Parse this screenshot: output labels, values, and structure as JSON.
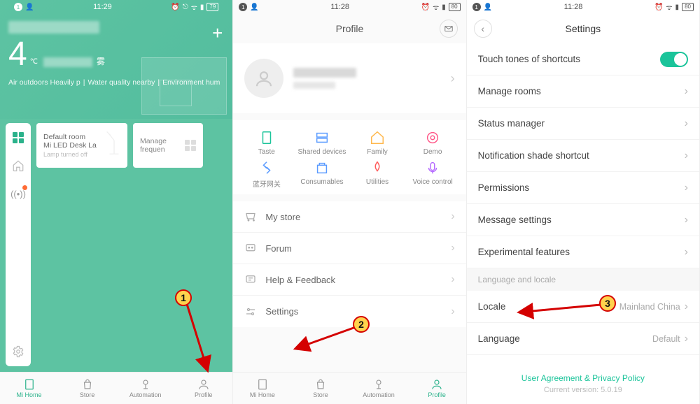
{
  "status": {
    "time_s1": "11:29",
    "time_s2": "11:28",
    "time_s3": "11:28",
    "batt_s1": "79",
    "batt_s2": "80",
    "batt_s3": "80",
    "notif": "1"
  },
  "home": {
    "temp_value": "4",
    "temp_unit": "℃",
    "temp_label": "雾",
    "info1": "Air outdoors Heavily p",
    "info2": "Water quality nearby",
    "info3": "Environment hum",
    "card1_title": "Default room",
    "card1_sub": "Mi LED Desk La",
    "card1_status": "Lamp turned off",
    "card2_label": "Manage frequen"
  },
  "tabs": {
    "home": "Mi Home",
    "store": "Store",
    "automation": "Automation",
    "profile": "Profile"
  },
  "profile": {
    "title": "Profile",
    "grid": [
      {
        "label": "Taste",
        "color": "#1bc49a"
      },
      {
        "label": "Shared devices",
        "color": "#5a9bff"
      },
      {
        "label": "Family",
        "color": "#ffb84d"
      },
      {
        "label": "Demo",
        "color": "#ff5a8a"
      },
      {
        "label": "蓝牙网关",
        "color": "#5a9bff"
      },
      {
        "label": "Consumables",
        "color": "#5a9bff"
      },
      {
        "label": "Utilities",
        "color": "#ff5a5a"
      },
      {
        "label": "Voice control",
        "color": "#b56aff"
      }
    ],
    "menu": [
      {
        "label": "My store",
        "icon": "cart"
      },
      {
        "label": "Forum",
        "icon": "forum"
      },
      {
        "label": "Help & Feedback",
        "icon": "help"
      },
      {
        "label": "Settings",
        "icon": "settings"
      }
    ]
  },
  "settings": {
    "title": "Settings",
    "rows": [
      {
        "label": "Touch tones of shortcuts",
        "type": "toggle"
      },
      {
        "label": "Manage rooms",
        "type": "nav"
      },
      {
        "label": "Status manager",
        "type": "nav"
      },
      {
        "label": "Notification shade shortcut",
        "type": "nav"
      },
      {
        "label": "Permissions",
        "type": "nav"
      },
      {
        "label": "Message settings",
        "type": "nav"
      },
      {
        "label": "Experimental features",
        "type": "nav"
      }
    ],
    "section": "Language and locale",
    "locale_label": "Locale",
    "locale_value": "Mainland China",
    "language_label": "Language",
    "language_value": "Default",
    "ua": "User Agreement & Privacy Policy",
    "version": "Current version: 5.0.19"
  },
  "annotations": {
    "a1": "1",
    "a2": "2",
    "a3": "3"
  }
}
